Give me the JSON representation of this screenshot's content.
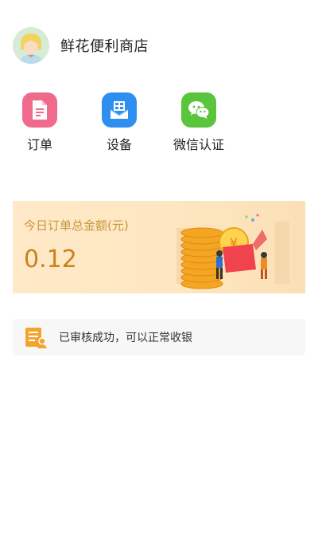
{
  "header": {
    "avatar_icon": "female-avatar-icon",
    "shop_name": "鲜花便利商店"
  },
  "actions": [
    {
      "label": "订单",
      "icon": "document-icon",
      "color": "#ef6a8b"
    },
    {
      "label": "设备",
      "icon": "device-box-icon",
      "color": "#2f8ff0"
    },
    {
      "label": "微信认证",
      "icon": "wechat-icon",
      "color": "#5ac43c"
    }
  ],
  "summary": {
    "title": "今日订单总金额(元)",
    "amount": "0.12",
    "illustration": "gold-coins-gift-illustration"
  },
  "notice": {
    "icon": "audit-approved-icon",
    "text": "已审核成功，可以正常收银"
  },
  "colors": {
    "banner_bg": "#fde6c0",
    "banner_text": "#c9973a",
    "amount_text": "#c9821e",
    "notice_bg": "#f7f7f7"
  }
}
